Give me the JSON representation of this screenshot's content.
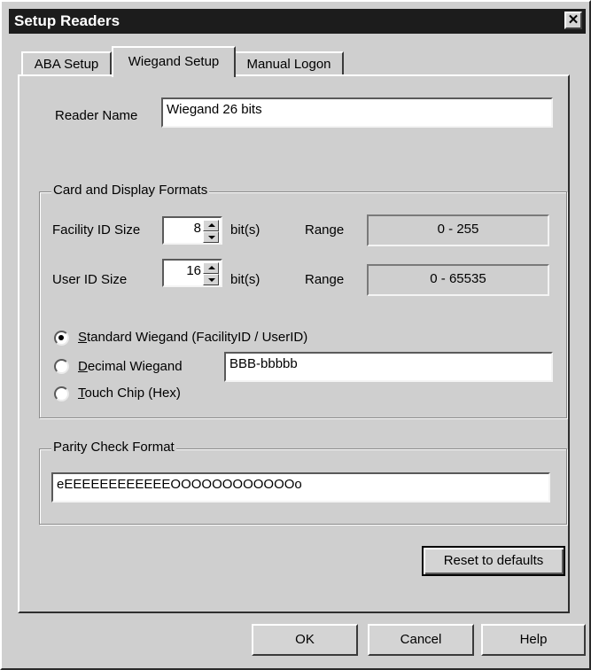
{
  "window": {
    "title": "Setup Readers",
    "close_glyph": "✕"
  },
  "tabs": [
    {
      "label": "ABA Setup",
      "active": false
    },
    {
      "label": "Wiegand Setup",
      "active": true
    },
    {
      "label": "Manual Logon",
      "active": false
    }
  ],
  "reader": {
    "name_label": "Reader Name",
    "name_value": "Wiegand 26 bits"
  },
  "formats": {
    "group_label": "Card and Display Formats",
    "facility": {
      "label": "Facility ID Size",
      "value": "8",
      "unit": "bit(s)",
      "range_label": "Range",
      "range_value": "0 - 255"
    },
    "user": {
      "label": "User ID Size",
      "value": "16",
      "unit": "bit(s)",
      "range_label": "Range",
      "range_value": "0 - 65535"
    },
    "options": [
      {
        "key": "S",
        "rest": "tandard Wiegand (FacilityID / UserID)",
        "selected": true
      },
      {
        "key": "D",
        "rest": "ecimal Wiegand",
        "selected": false
      },
      {
        "key": "T",
        "rest": "ouch Chip (Hex)",
        "selected": false
      }
    ],
    "decimal_format_value": "BBB-bbbbb"
  },
  "parity": {
    "group_label": "Parity Check Format",
    "value": "eEEEEEEEEEEEEOOOOOOOOOOOOo"
  },
  "buttons": {
    "reset": "Reset to defaults",
    "ok": "OK",
    "cancel": "Cancel",
    "help": "Help"
  }
}
